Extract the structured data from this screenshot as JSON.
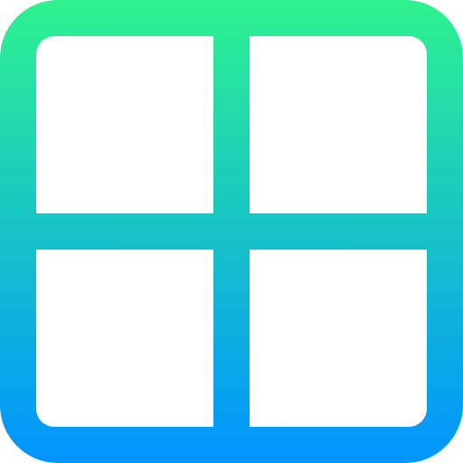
{
  "icon": {
    "name": "grid-layout-icon",
    "gradient_top": "#2ef28f",
    "gradient_bottom": "#0094ff",
    "background": "#ffffff"
  }
}
